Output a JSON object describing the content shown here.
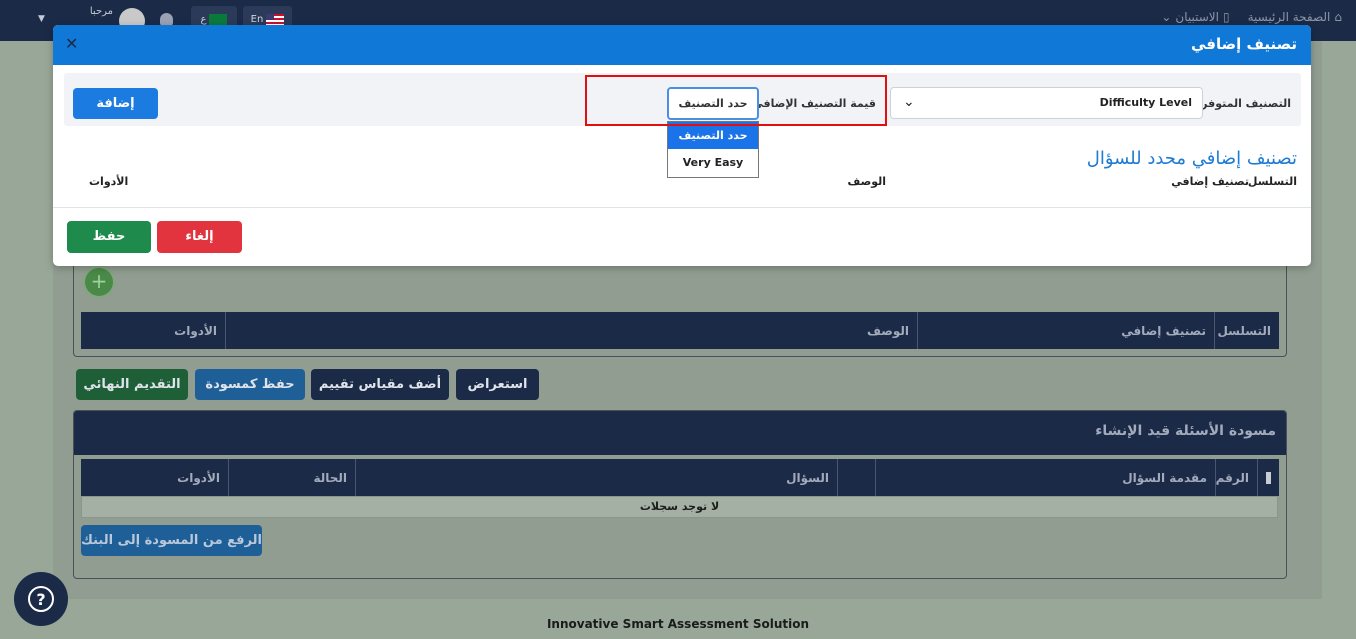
{
  "topnav": {
    "items": [
      "الصفحة الرئيسية",
      "الاستبيان"
    ],
    "lang_en": "En",
    "lang_ar": "ع",
    "greeting": "مرحبا"
  },
  "background": {
    "table1": {
      "headers": [
        "التسلسل",
        "تصنيف إضافي",
        "الوصف",
        "الأدوات"
      ]
    },
    "actions": [
      "استعراض",
      "أضف مقياس تقييم",
      "حفظ كمسودة",
      "التقديم النهائي"
    ],
    "draft": {
      "title": "مسودة الأسئلة قيد الإنشاء",
      "headers": [
        "الرقم",
        "مقدمة السؤال",
        "السؤال",
        "الحالة",
        "الأدوات"
      ],
      "empty": "لا توجد سجلات",
      "upload_label": "الرفع من المسودة إلى البنك"
    },
    "footer": "Innovative Smart Assessment Solution"
  },
  "modal": {
    "title": "تصنيف إضافي",
    "available_label": "التصنيف المتوفر:",
    "available_value": "Difficulty Level",
    "value_label": "قيمة التصنيف الإضافي",
    "value_selected": "حدد التصنيف",
    "dropdown_options": [
      "حدد التصنيف",
      "Very Easy"
    ],
    "add_label": "إضافة",
    "section_title": "تصنيف إضافي محدد للسؤال",
    "columns": {
      "seq": "التسلسل",
      "extra": "تصنيف إضافي",
      "desc": "الوصف",
      "tools": "الأدوات"
    },
    "save_label": "حفظ",
    "cancel_label": "إلغاء"
  },
  "colors": {
    "primary": "#1079d8",
    "highlight": "#e01010",
    "save": "#1e8a4c",
    "cancel": "#e1343f",
    "nav": "#1b2a47"
  }
}
